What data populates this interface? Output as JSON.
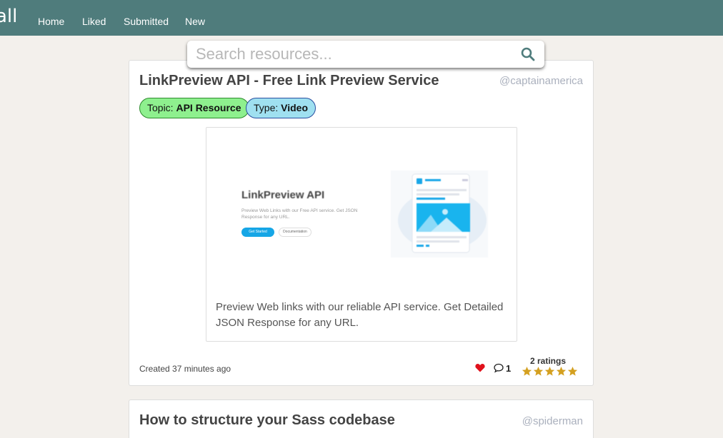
{
  "nav": {
    "brand": "all",
    "links": [
      "Home",
      "Liked",
      "Submitted",
      "New"
    ]
  },
  "search": {
    "placeholder": "Search resources...",
    "value": "",
    "icon": "search-icon"
  },
  "colors": {
    "navbar": "#4f7c7c",
    "search_icon": "#4f7c7c",
    "topic_tag_bg": "#8ef08e",
    "type_tag_bg": "#9fe0f0",
    "heart": "#e0111c",
    "star": "#d4a020"
  },
  "resources": [
    {
      "title": "LinkPreview API - Free Link Preview Service",
      "author": "@captainamerica",
      "topic_label": "Topic:",
      "topic": "API Resource",
      "type_label": "Type:",
      "type": "Video",
      "thumbnail": {
        "heading": "LinkPreview API",
        "subtext": "Preview Web Links with our Free API service. Get JSON Response for any URL.",
        "primary_button": "Get Started",
        "secondary_button": "Documentation"
      },
      "description": "Preview Web links with our reliable API service. Get Detailed JSON Response for any URL.",
      "created": "Created 37 minutes ago",
      "liked": true,
      "comments": "1",
      "ratings_label": "2 ratings",
      "rating": 5,
      "rating_max": 5
    },
    {
      "title": "How to structure your Sass codebase",
      "author": "@spiderman"
    }
  ]
}
